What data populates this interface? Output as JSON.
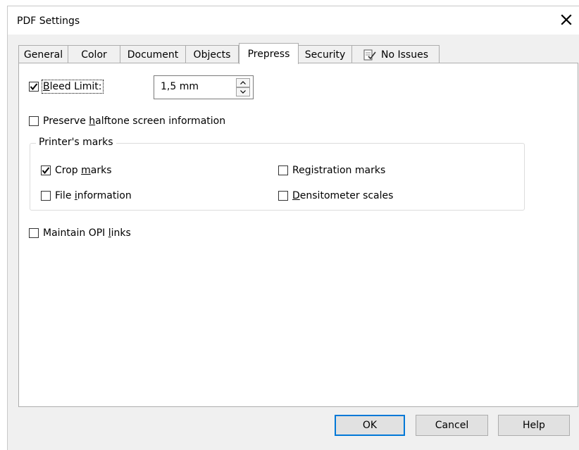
{
  "window": {
    "title": "PDF Settings"
  },
  "tabs": [
    {
      "label": "General",
      "active": false
    },
    {
      "label": "Color",
      "active": false
    },
    {
      "label": "Document",
      "active": false
    },
    {
      "label": "Objects",
      "active": false
    },
    {
      "label": "Prepress",
      "active": true
    },
    {
      "label": "Security",
      "active": false
    },
    {
      "label": "No Issues",
      "active": false,
      "icon": "no-issues-icon"
    }
  ],
  "prepress": {
    "bleed_limit": {
      "label_pre": "",
      "label_mnemonic": "B",
      "label_post": "leed Limit:",
      "checked": true,
      "value": "1,5 mm"
    },
    "preserve_halftone": {
      "label_pre": "Preserve ",
      "label_mnemonic": "h",
      "label_post": "alftone screen information",
      "checked": false
    },
    "printers_marks": {
      "legend": "Printer's marks",
      "crop_marks": {
        "label_pre": "Crop ",
        "label_mnemonic": "m",
        "label_post": "arks",
        "checked": true
      },
      "file_information": {
        "label_pre": "File ",
        "label_mnemonic": "i",
        "label_post": "nformation",
        "checked": false
      },
      "registration_marks": {
        "label_pre": "Re",
        "label_mnemonic": "g",
        "label_post": "istration marks",
        "checked": false
      },
      "densitometer_scales": {
        "label_pre": "",
        "label_mnemonic": "D",
        "label_post": "ensitometer scales",
        "checked": false
      }
    },
    "maintain_opi": {
      "label_pre": "Maintain OPI ",
      "label_mnemonic": "l",
      "label_post": "inks",
      "checked": false
    }
  },
  "buttons": {
    "ok": "OK",
    "cancel": "Cancel",
    "help": "Help"
  }
}
